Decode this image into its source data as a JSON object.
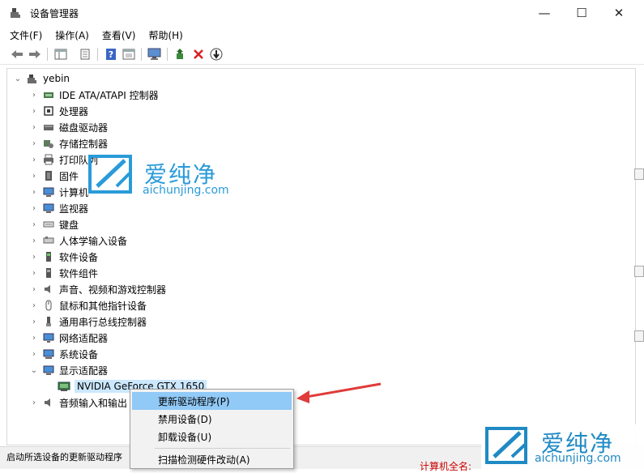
{
  "window": {
    "title": "设备管理器",
    "minimize_glyph": "—",
    "maximize_glyph": "☐",
    "close_glyph": "✕"
  },
  "menubar": {
    "items": [
      "文件(F)",
      "操作(A)",
      "查看(V)",
      "帮助(H)"
    ]
  },
  "toolbar": {
    "icons": [
      "back-icon",
      "forward-icon",
      "properties-pane-icon",
      "properties-icon",
      "help-icon",
      "device-view-icon",
      "monitor-scan-icon",
      "enable-device-icon",
      "uninstall-icon",
      "update-driver-icon"
    ]
  },
  "tree": {
    "root": "yebin",
    "categories": [
      {
        "label": "IDE ATA/ATAPI 控制器",
        "icon": "ide-controller-icon",
        "expander": "›"
      },
      {
        "label": "处理器",
        "icon": "processor-icon",
        "expander": "›"
      },
      {
        "label": "磁盘驱动器",
        "icon": "disk-drive-icon",
        "expander": "›"
      },
      {
        "label": "存储控制器",
        "icon": "storage-controller-icon",
        "expander": "›"
      },
      {
        "label": "打印队列",
        "icon": "printer-icon",
        "expander": "›"
      },
      {
        "label": "固件",
        "icon": "firmware-icon",
        "expander": "›"
      },
      {
        "label": "计算机",
        "icon": "computer-icon",
        "expander": "›"
      },
      {
        "label": "监视器",
        "icon": "monitor-icon",
        "expander": "›"
      },
      {
        "label": "键盘",
        "icon": "keyboard-icon",
        "expander": "›"
      },
      {
        "label": "人体学输入设备",
        "icon": "hid-icon",
        "expander": "›"
      },
      {
        "label": "软件设备",
        "icon": "software-device-icon",
        "expander": "›"
      },
      {
        "label": "软件组件",
        "icon": "software-component-icon",
        "expander": "›"
      },
      {
        "label": "声音、视频和游戏控制器",
        "icon": "sound-icon",
        "expander": "›"
      },
      {
        "label": "鼠标和其他指针设备",
        "icon": "mouse-icon",
        "expander": "›"
      },
      {
        "label": "通用串行总线控制器",
        "icon": "usb-icon",
        "expander": "›"
      },
      {
        "label": "网络适配器",
        "icon": "network-adapter-icon",
        "expander": "›"
      },
      {
        "label": "系统设备",
        "icon": "system-device-icon",
        "expander": "›"
      },
      {
        "label": "显示适配器",
        "icon": "display-adapter-icon",
        "expander": "⌄"
      }
    ],
    "gpu": "NVIDIA GeForce GTX 1650",
    "after": "音频输入和输出"
  },
  "context_menu": {
    "items": [
      "更新驱动程序(P)",
      "禁用设备(D)",
      "卸载设备(U)",
      "扫描检测硬件改动(A)"
    ]
  },
  "statusbar": {
    "text": "启动所选设备的更新驱动程序",
    "right_text": "计算机全名:"
  },
  "watermark": {
    "brand_cn": "爱纯净",
    "brand_url": "aichunjing.com"
  },
  "colors": {
    "selection": "#cce8ff",
    "menu_highlight": "#91c9f7",
    "watermark": "#2a9bd8",
    "arrow": "#e03b3b"
  }
}
